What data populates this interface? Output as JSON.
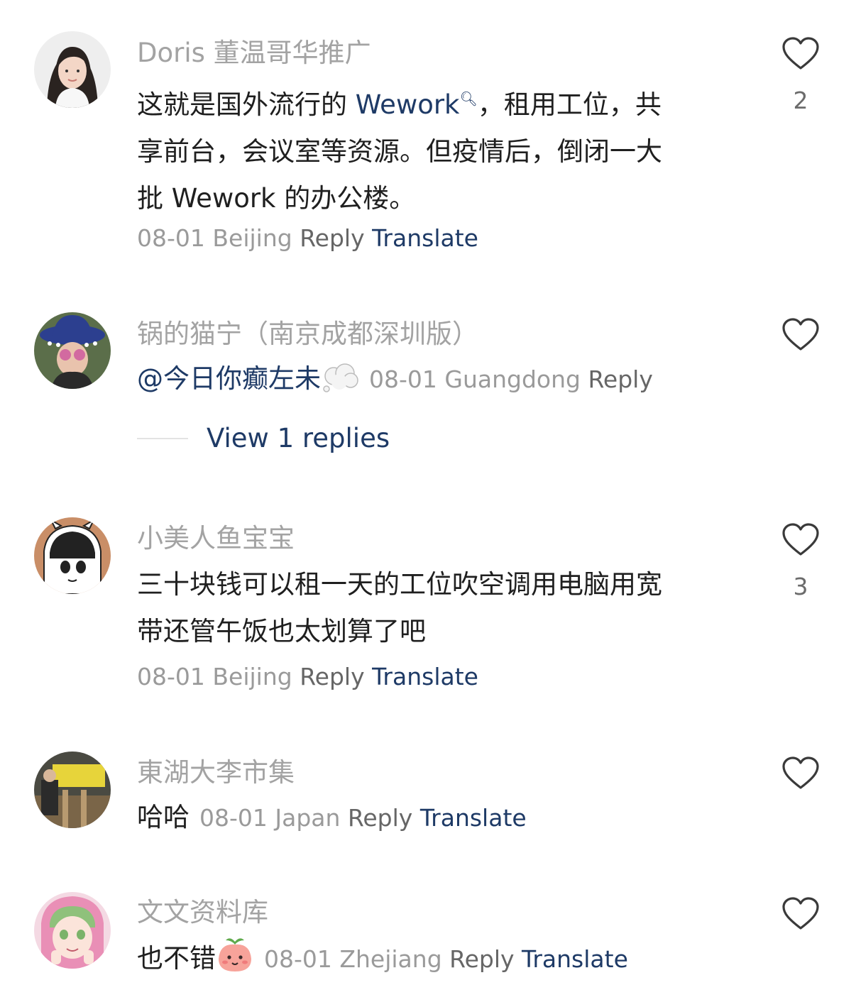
{
  "comments": [
    {
      "username": "Doris 董温哥华推广",
      "text_line1_pre": "这就是国外流行的 ",
      "text_link": "Wework",
      "text_line1_post": "，租用工位，共",
      "text_line2": "享前台，会议室等资源。但疫情后，倒闭一大",
      "text_line3": "批 Wework 的办公楼。",
      "date": "08-01",
      "location": "Beijing",
      "reply": "Reply",
      "translate": "Translate",
      "likes": "2",
      "avatar_icon": "avatar-woman-photo"
    },
    {
      "username": "锅的猫宁（南京成都深圳版）",
      "mention": "@今日你癫左未",
      "emoji": "thought-bubble-emoji",
      "date": "08-01",
      "location": "Guangdong",
      "reply": "Reply",
      "view_replies": "View 1 replies",
      "avatar_icon": "avatar-hat-sunglasses"
    },
    {
      "username": "小美人鱼宝宝",
      "text_line1": "三十块钱可以租一天的工位吹空调用电脑用宽",
      "text_line2": "带还管午饭也太划算了吧",
      "date": "08-01",
      "location": "Beijing",
      "reply": "Reply",
      "translate": "Translate",
      "likes": "3",
      "avatar_icon": "avatar-cartoon-girl"
    },
    {
      "username": "東湖大李市集",
      "text": "哈哈",
      "date": "08-01",
      "location": "Japan",
      "reply": "Reply",
      "translate": "Translate",
      "avatar_icon": "avatar-market-sign"
    },
    {
      "username": "文文资料库",
      "text": "也不错",
      "emoji": "peach-face-emoji",
      "date": "08-01",
      "location": "Zhejiang",
      "reply": "Reply",
      "translate": "Translate",
      "avatar_icon": "avatar-anime-girl"
    }
  ],
  "colors": {
    "link": "#1e3a66",
    "username": "#a3a3a3",
    "text": "#1f1f1f",
    "meta": "#9a9a9a"
  },
  "icons": {
    "like": "heart-outline-icon"
  }
}
